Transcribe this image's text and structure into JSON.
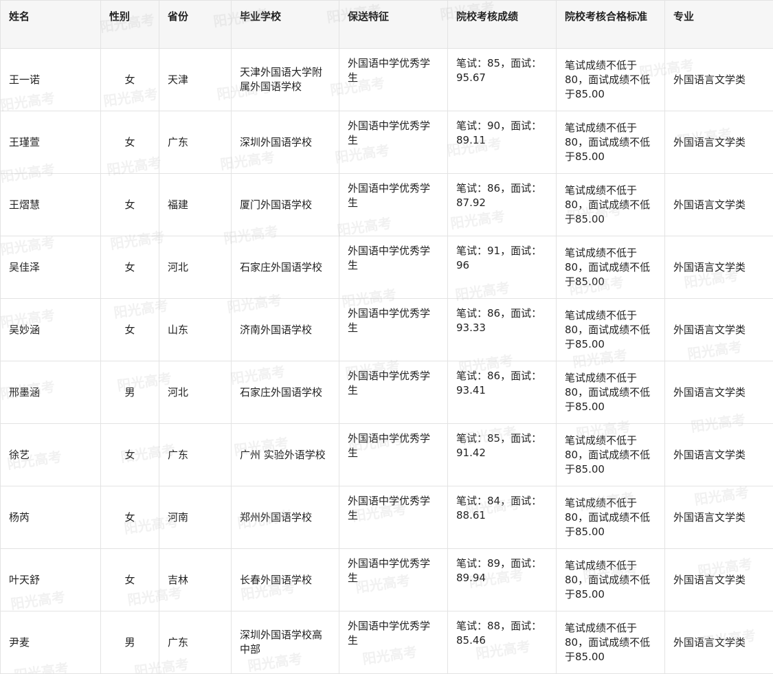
{
  "headers": [
    "姓名",
    "性别",
    "省份",
    "毕业学校",
    "保送特征",
    "院校考核成绩",
    "院校考核合格标准",
    "专业"
  ],
  "rows": [
    {
      "name": "王一诺",
      "gender": "女",
      "province": "天津",
      "school": "天津外国语大学附属外国语学校",
      "feature": "外国语中学优秀学生",
      "score": "笔试：85，面试：95.67",
      "standard": "笔试成绩不低于80，面试成绩不低于85.00",
      "major": "外国语言文学类"
    },
    {
      "name": "王瑾萱",
      "gender": "女",
      "province": "广东",
      "school": "深圳外国语学校",
      "feature": "外国语中学优秀学生",
      "score": "笔试：90，面试：89.11",
      "standard": "笔试成绩不低于80，面试成绩不低于85.00",
      "major": "外国语言文学类"
    },
    {
      "name": "王熠慧",
      "gender": "女",
      "province": "福建",
      "school": "厦门外国语学校",
      "feature": "外国语中学优秀学生",
      "score": "笔试：86，面试：87.92",
      "standard": "笔试成绩不低于80，面试成绩不低于85.00",
      "major": "外国语言文学类"
    },
    {
      "name": "吴佳泽",
      "gender": "女",
      "province": "河北",
      "school": "石家庄外国语学校",
      "feature": "外国语中学优秀学生",
      "score": "笔试：91，面试：96",
      "standard": "笔试成绩不低于80，面试成绩不低于85.00",
      "major": "外国语言文学类"
    },
    {
      "name": "吴妙涵",
      "gender": "女",
      "province": "山东",
      "school": "济南外国语学校",
      "feature": "外国语中学优秀学生",
      "score": "笔试：86，面试：93.33",
      "standard": "笔试成绩不低于80，面试成绩不低于85.00",
      "major": "外国语言文学类"
    },
    {
      "name": "邢墨涵",
      "gender": "男",
      "province": "河北",
      "school": "石家庄外国语学校",
      "feature": "外国语中学优秀学生",
      "score": "笔试：86，面试：93.41",
      "standard": "笔试成绩不低于80，面试成绩不低于85.00",
      "major": "外国语言文学类"
    },
    {
      "name": "徐艺",
      "gender": "女",
      "province": "广东",
      "school": "广州 实验外语学校",
      "feature": "外国语中学优秀学生",
      "score": "笔试：85，面试：91.42",
      "standard": "笔试成绩不低于80，面试成绩不低于85.00",
      "major": "外国语言文学类"
    },
    {
      "name": "杨芮",
      "gender": "女",
      "province": "河南",
      "school": "郑州外国语学校",
      "feature": "外国语中学优秀学生",
      "score": "笔试：84，面试：88.61",
      "standard": "笔试成绩不低于80，面试成绩不低于85.00",
      "major": "外国语言文学类"
    },
    {
      "name": "叶天舒",
      "gender": "女",
      "province": "吉林",
      "school": "长春外国语学校",
      "feature": "外国语中学优秀学生",
      "score": "笔试：89，面试：89.94",
      "standard": "笔试成绩不低于80，面试成绩不低于85.00",
      "major": "外国语言文学类"
    },
    {
      "name": "尹麦",
      "gender": "男",
      "province": "广东",
      "school": "深圳外国语学校高中部",
      "feature": "外国语中学优秀学生",
      "score": "笔试：88，面试：85.46",
      "standard": "笔试成绩不低于80，面试成绩不低于85.00",
      "major": "外国语言文学类"
    }
  ],
  "watermark": "阳光高考"
}
